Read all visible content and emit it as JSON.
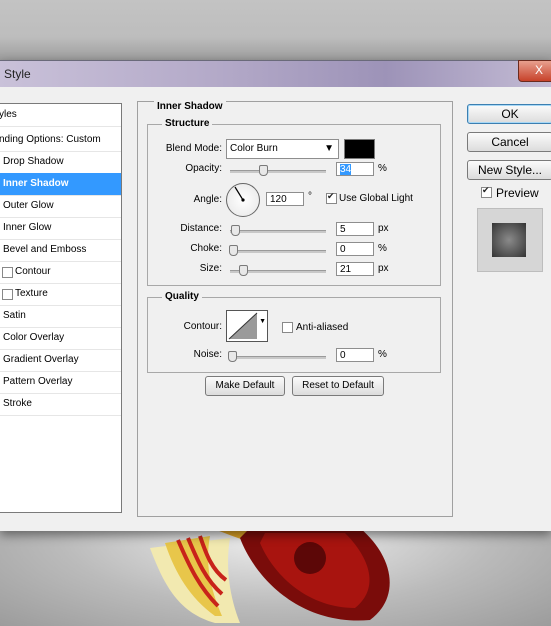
{
  "window": {
    "title": "Style",
    "close_label": "X"
  },
  "style_list": {
    "items": [
      {
        "label": "yles"
      },
      {
        "label": "nding Options: Custom"
      },
      {
        "label": "Drop Shadow"
      },
      {
        "label": "Inner Shadow"
      },
      {
        "label": "Outer Glow"
      },
      {
        "label": "Inner Glow"
      },
      {
        "label": "Bevel and Emboss"
      },
      {
        "label": "Contour"
      },
      {
        "label": "Texture"
      },
      {
        "label": "Satin"
      },
      {
        "label": "Color Overlay"
      },
      {
        "label": "Gradient Overlay"
      },
      {
        "label": "Pattern Overlay"
      },
      {
        "label": "Stroke"
      }
    ],
    "selected": "Inner Shadow"
  },
  "inner_shadow": {
    "title": "Inner Shadow",
    "structure": {
      "title": "Structure",
      "blend_mode_label": "Blend Mode:",
      "blend_mode_value": "Color Burn",
      "shadow_color": "#000000",
      "opacity_label": "Opacity:",
      "opacity_value": "34",
      "angle_label": "Angle:",
      "angle_value": "120",
      "degree_symbol": "°",
      "use_global_light_label": "Use Global Light",
      "use_global_light_checked": true,
      "distance_label": "Distance:",
      "distance_value": "5",
      "choke_label": "Choke:",
      "choke_value": "0",
      "size_label": "Size:",
      "size_value": "21",
      "unit_px": "px",
      "unit_pct": "%"
    },
    "quality": {
      "title": "Quality",
      "contour_label": "Contour:",
      "anti_aliased_label": "Anti-aliased",
      "anti_aliased_checked": false,
      "noise_label": "Noise:",
      "noise_value": "0"
    },
    "make_default_label": "Make Default",
    "reset_default_label": "Reset to Default"
  },
  "buttons": {
    "ok": "OK",
    "cancel": "Cancel",
    "new_style": "New Style...",
    "preview_label": "Preview",
    "preview_checked": true
  },
  "colors": {
    "selection": "#3399ff",
    "panel_bg": "#f0f0f0"
  }
}
